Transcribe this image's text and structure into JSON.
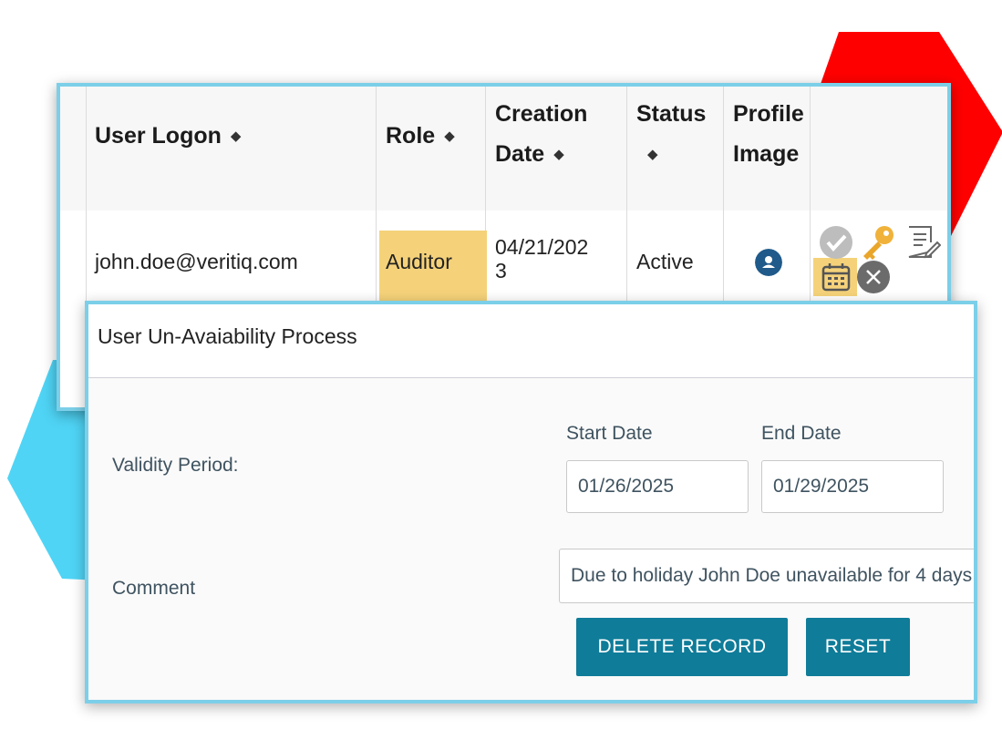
{
  "table": {
    "columns": [
      {
        "label": "User Logon",
        "sort_icon": "sort-icon"
      },
      {
        "label": "Role",
        "sort_icon": "sort-icon"
      },
      {
        "label_line1": "Creation",
        "label_line2": "Date",
        "sort_icon": "sort-icon"
      },
      {
        "label": "Status",
        "sort_icon": "sort-icon"
      },
      {
        "label_line1": "Profile",
        "label_line2": "Image"
      }
    ],
    "row": {
      "user_logon": "john.doe@veritiq.com",
      "role": "Auditor",
      "creation_date_line1": "04/21/202",
      "creation_date_line2": "3",
      "status": "Active",
      "profile_icon": "user-avatar-icon",
      "actions": [
        "check-icon",
        "key-icon",
        "edit-notes-icon",
        "calendar-icon",
        "close-icon"
      ]
    }
  },
  "modal": {
    "title": "User Un-Avaiability Process",
    "validity_label": "Validity Period:",
    "start_date_label": "Start Date",
    "start_date_value": "01/26/2025",
    "end_date_label": "End Date",
    "end_date_value": "01/29/2025",
    "comment_label": "Comment",
    "comment_value": "Due to holiday John Doe unavailable for 4 days",
    "delete_button": "DELETE RECORD",
    "reset_button": "RESET"
  },
  "colors": {
    "accent_border": "#7ccfe8",
    "button": "#0f7c99",
    "highlight": "#f5d27a",
    "decor_red": "#ff0000",
    "decor_blue": "#4fd4f5"
  }
}
